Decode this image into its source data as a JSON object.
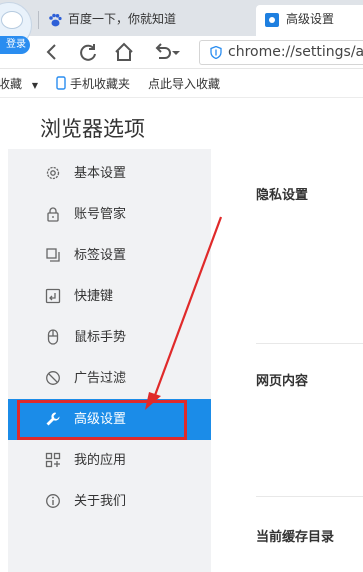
{
  "browser": {
    "login_badge": "登录",
    "tabs": [
      {
        "title": "百度一下，你就知道",
        "favicon": "baidu-paw-icon"
      },
      {
        "title": "高级设置",
        "favicon": "settings-gear-icon",
        "active": true
      }
    ],
    "address": {
      "url": "chrome://settings/ad",
      "icon": "shield-icon"
    },
    "bookmarks": [
      {
        "label": "收藏",
        "has_dropdown": true
      },
      {
        "label": "手机收藏夹",
        "icon": "phone-icon"
      },
      {
        "label": "点此导入收藏"
      }
    ]
  },
  "settings": {
    "title": "浏览器选项",
    "sidebar": [
      {
        "label": "基本设置",
        "icon": "gear-icon"
      },
      {
        "label": "账号管家",
        "icon": "lock-icon"
      },
      {
        "label": "标签设置",
        "icon": "tabs-icon"
      },
      {
        "label": "快捷键",
        "icon": "shortcut-icon"
      },
      {
        "label": "鼠标手势",
        "icon": "mouse-icon"
      },
      {
        "label": "广告过滤",
        "icon": "block-icon"
      },
      {
        "label": "高级设置",
        "icon": "wrench-icon",
        "active": true
      },
      {
        "label": "我的应用",
        "icon": "apps-icon"
      },
      {
        "label": "关于我们",
        "icon": "info-icon"
      }
    ],
    "sections": [
      "隐私设置",
      "网页内容",
      "当前缓存目录"
    ]
  },
  "colors": {
    "accent": "#1b8ce8",
    "annotation": "#e02a2a"
  }
}
